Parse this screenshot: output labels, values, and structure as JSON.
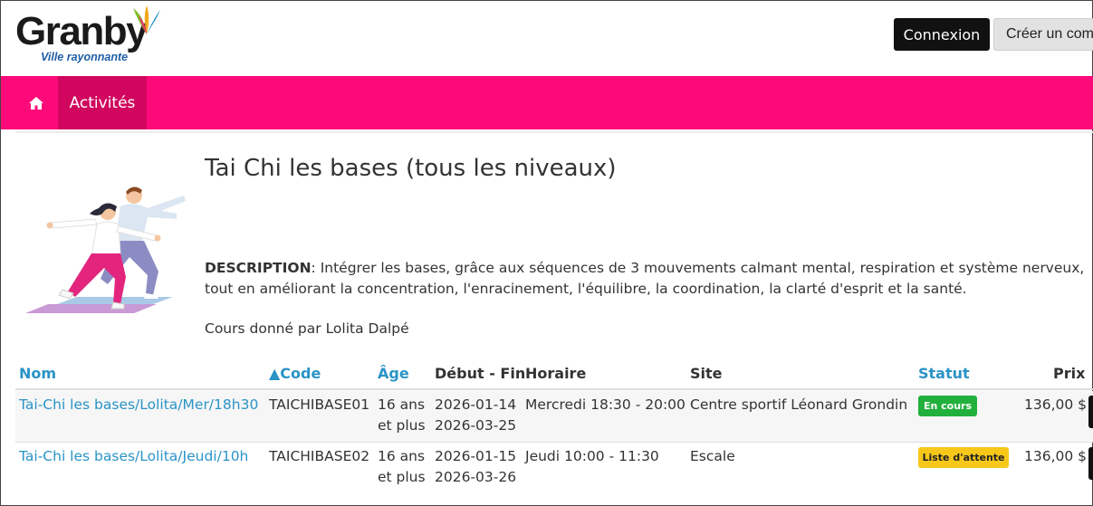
{
  "header": {
    "logo_text": "Granby",
    "logo_tagline": "Ville rayonnante",
    "login_label": "Connexion",
    "signup_label": "Créer un compte"
  },
  "nav": {
    "home_icon": "home-icon",
    "activities_label": "Activités"
  },
  "activity": {
    "title": "Tai Chi les bases (tous les niveaux)",
    "description_label": "DESCRIPTION",
    "description_text": ": Intégrer les bases, grâce aux séquences de 3 mouvements calmant mental, respiration et système nerveux, tout en améliorant la concentration, l'enracinement, l'équilibre, la coordination, la clarté d'esprit et la santé.",
    "teacher_text": "Cours donné par Lolita Dalpé"
  },
  "table": {
    "headers": {
      "nom": "Nom",
      "code": "▲Code",
      "age": "Âge",
      "dates": "Début - Fin",
      "horaire": "Horaire",
      "site": "Site",
      "statut": "Statut",
      "prix": "Prix"
    },
    "rows": [
      {
        "nom": "Tai-Chi les bases/Lolita/Mer/18h30",
        "code": "TAICHIBASE01",
        "age_line1": "16 ans",
        "age_line2": "et plus",
        "debut": "2026-01-14",
        "fin": "2026-03-25",
        "horaire": "Mercredi 18:30 - 20:00",
        "site": "Centre sportif Léonard Grondin",
        "statut": "En cours",
        "prix": "136,00 $"
      },
      {
        "nom": "Tai-Chi les bases/Lolita/Jeudi/10h",
        "code": "TAICHIBASE02",
        "age_line1": "16 ans",
        "age_line2": "et plus",
        "debut": "2026-01-15",
        "fin": "2026-03-26",
        "horaire": "Jeudi 10:00 - 11:30",
        "site": "Escale",
        "statut": "Liste d'attente",
        "prix": "136,00 $"
      }
    ]
  },
  "colors": {
    "nav_bg": "#fc0a7a",
    "nav_active": "#d1075f",
    "link": "#2a93c6",
    "status_green": "#22b03d",
    "status_yellow": "#f7c81a"
  }
}
